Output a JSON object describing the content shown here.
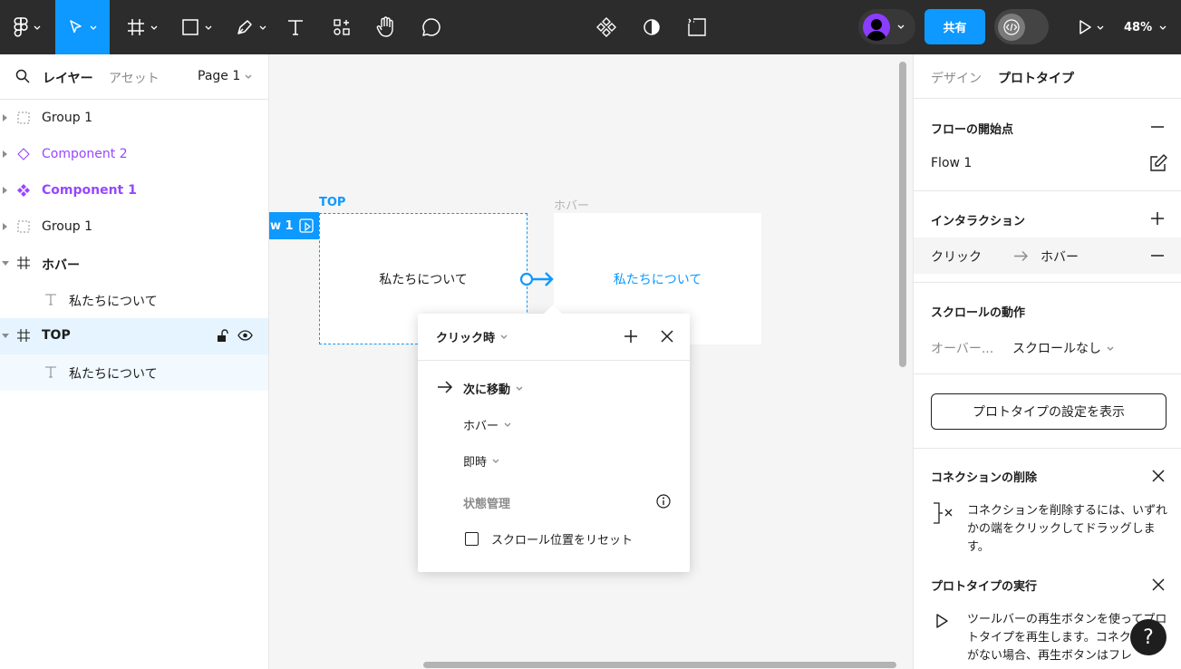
{
  "toolbar": {
    "share_label": "共有",
    "zoom": "48%"
  },
  "left_panel": {
    "tab_layers": "レイヤー",
    "tab_assets": "アセット",
    "page": "Page 1",
    "layers": [
      {
        "name": "Group 1"
      },
      {
        "name": "Component 2"
      },
      {
        "name": "Component 1"
      },
      {
        "name": "Group 1"
      },
      {
        "name": "ホバー"
      },
      {
        "name": "私たちについて"
      },
      {
        "name": "TOP"
      },
      {
        "name": "私たちについて"
      }
    ]
  },
  "canvas": {
    "frame_top_label": "TOP",
    "frame_top_text": "私たちについて",
    "frame_hover_label": "ホバー",
    "frame_hover_text": "私たちについて",
    "flow_tag": "w 1"
  },
  "popover": {
    "trigger": "クリック時",
    "action": "次に移動",
    "destination": "ホバー",
    "animation": "即時",
    "state_label": "状態管理",
    "reset_scroll": "スクロール位置をリセット"
  },
  "right_panel": {
    "tab_design": "デザイン",
    "tab_prototype": "プロトタイプ",
    "flow_start_title": "フローの開始点",
    "flow_name": "Flow 1",
    "interaction_title": "インタラクション",
    "interaction_trigger": "クリック",
    "interaction_target": "ホバー",
    "scroll_title": "スクロールの動作",
    "overflow_label": "オーバー...",
    "overflow_value": "スクロールなし",
    "settings_button": "プロトタイプの設定を表示",
    "delete_title": "コネクションの削除",
    "delete_tip": "コネクションを削除するには、いずれかの端をクリックしてドラッグします。",
    "run_title": "プロトタイプの実行",
    "run_tip": "ツールバーの再生ボタンを使ってプロトタイプを再生します。コネクションがない場合、再生ボタンはフレ"
  },
  "help_label": "?",
  "colors": {
    "accent": "#0d99ff",
    "component": "#9747ff",
    "toolbar_bg": "#2c2c2c"
  }
}
